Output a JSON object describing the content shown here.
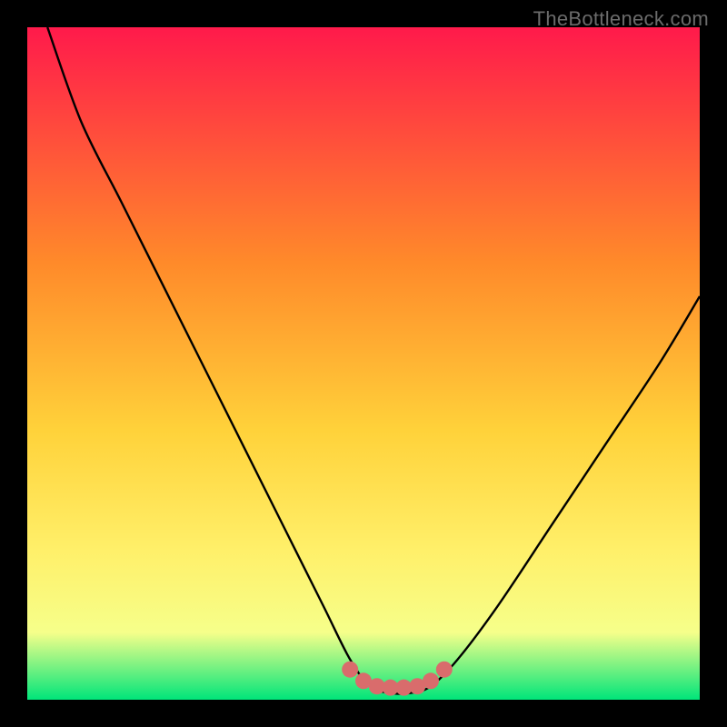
{
  "watermark": "TheBottleneck.com",
  "colors": {
    "bg": "#000000",
    "watermark": "#6b6b6b",
    "curve": "#000000",
    "marker": "#d96c6c",
    "grad_top": "#ff1a4b",
    "grad_mid1": "#ff8a2a",
    "grad_mid2": "#ffd23a",
    "grad_mid3": "#fff06a",
    "grad_band": "#f6ff8a",
    "grad_bot": "#00e57a"
  },
  "chart_data": {
    "type": "line",
    "title": "",
    "xlabel": "",
    "ylabel": "",
    "xlim": [
      0,
      100
    ],
    "ylim": [
      0,
      100
    ],
    "series": [
      {
        "name": "bottleneck-curve",
        "x": [
          3,
          8,
          14,
          20,
          26,
          32,
          38,
          44,
          48,
          51,
          54,
          57,
          60,
          64,
          70,
          78,
          86,
          94,
          100
        ],
        "y": [
          100,
          86,
          74,
          62,
          50,
          38,
          26,
          14,
          6,
          2,
          1,
          1,
          2,
          6,
          14,
          26,
          38,
          50,
          60
        ]
      }
    ],
    "markers": {
      "name": "optimal-range",
      "x": [
        48,
        50,
        52,
        54,
        56,
        58,
        60,
        62
      ],
      "y": [
        4.5,
        2.8,
        2.0,
        1.8,
        1.8,
        2.0,
        2.8,
        4.5
      ]
    },
    "notes": "Background is a vertical rainbow gradient (red→orange→yellow→green). Curve is a V-shaped bottleneck profile with minimum near x≈55, y≈1. Marker dots highlight the flat bottom of the V. No axis ticks or labels shown."
  }
}
